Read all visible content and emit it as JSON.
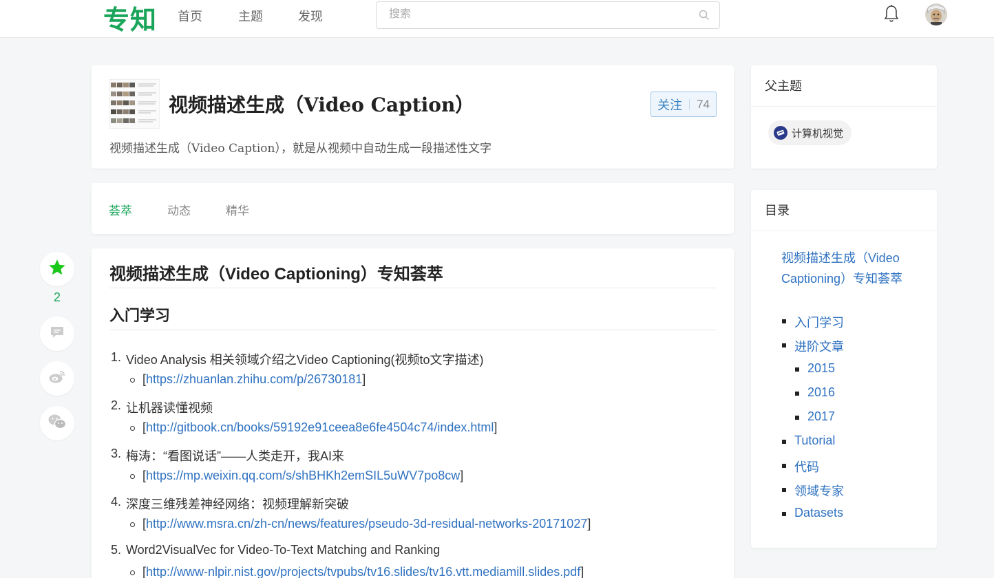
{
  "header": {
    "logo": "专知",
    "nav": [
      "首页",
      "主题",
      "发现"
    ],
    "search_placeholder": "搜索"
  },
  "topic": {
    "title": "视频描述生成（Video Caption）",
    "description": "视频描述生成（Video Caption），就是从视频中自动生成一段描述性文字",
    "follow_label": "关注",
    "follow_count": "74"
  },
  "tabs": [
    "荟萃",
    "动态",
    "精华"
  ],
  "actions": {
    "star_count": "2"
  },
  "article": {
    "title": "视频描述生成（Video Captioning）专知荟萃",
    "section": "入门学习",
    "items": [
      {
        "num": "1.",
        "text": "Video Analysis 相关领域介绍之Video Captioning(视频to文字描述)",
        "url": "https://zhuanlan.zhihu.com/p/26730181"
      },
      {
        "num": "2.",
        "text": "让机器读懂视频",
        "url": "http://gitbook.cn/books/59192e91ceea8e6fe4504c74/index.html"
      },
      {
        "num": "3.",
        "text": "梅涛：“看图说话”——人类走开，我AI来",
        "url": "https://mp.weixin.qq.com/s/shBHKh2emSIL5uWV7po8cw"
      },
      {
        "num": "4.",
        "text": "深度三维残差神经网络：视频理解新突破",
        "url": "http://www.msra.cn/zh-cn/news/features/pseudo-3d-residual-networks-20171027"
      },
      {
        "num": "5.",
        "text": "Word2VisualVec for Video-To-Text Matching and Ranking",
        "url": "http://www-nlpir.nist.gov/projects/tvpubs/tv16.slides/tv16.vtt.mediamill.slides.pdf"
      }
    ]
  },
  "parent_topics": {
    "heading": "父主题",
    "items": [
      "计算机视觉"
    ]
  },
  "toc": {
    "heading": "目录",
    "title": "视频描述生成（Video Captioning）专知荟萃",
    "items": [
      "入门学习",
      "进阶文章",
      "2015",
      "2016",
      "2017",
      "Tutorial",
      "代码",
      "领域专家",
      "Datasets"
    ]
  },
  "colors": {
    "brand_green": "#1aa55a",
    "link_blue": "#2f72c1"
  }
}
